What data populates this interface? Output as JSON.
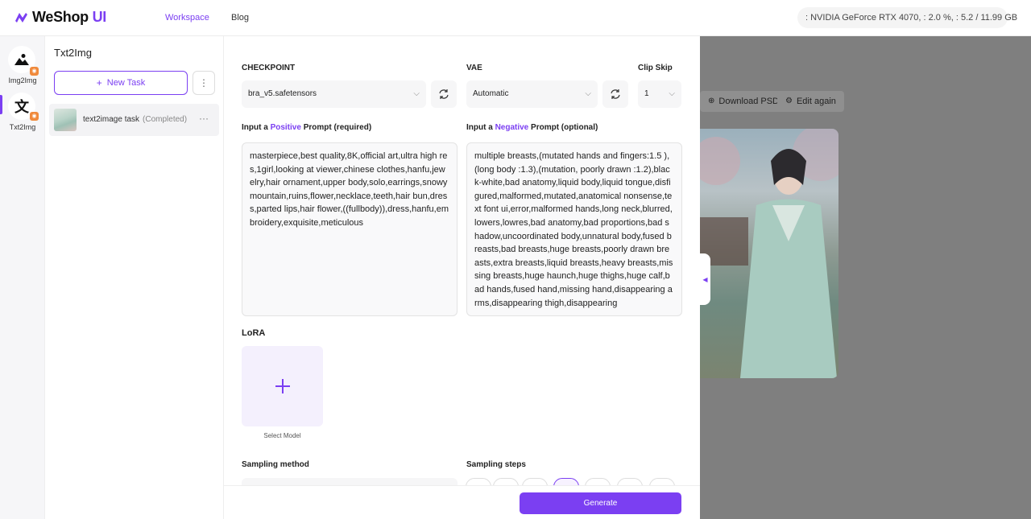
{
  "brand": {
    "name": "WeShop",
    "suffix": " UI"
  },
  "nav": {
    "workspace": "Workspace",
    "blog": "Blog"
  },
  "gpu": {
    "info": ": NVIDIA GeForce RTX 4070, : 2.0 %, : 5.2 / 11.99 GB"
  },
  "rail": {
    "items": [
      {
        "label": "Img2Img",
        "icon": "landscape-icon"
      },
      {
        "label": "Txt2Img",
        "icon": "translate-icon"
      }
    ]
  },
  "tasks": {
    "title": "Txt2Img",
    "new_task": "New Task",
    "items": [
      {
        "name": "text2image task",
        "status": "(Completed)"
      }
    ]
  },
  "preview": {
    "download_psd": "Download PSD",
    "edit_again": "Edit again"
  },
  "controls": {
    "checkpoint_label": "CHECKPOINT",
    "checkpoint_value": "bra_v5.safetensors",
    "vae_label": "VAE",
    "vae_value": "Automatic",
    "clip_skip_label": "Clip Skip",
    "clip_skip_value": "1",
    "positive_label_pre": "Input a ",
    "positive_word": "Positive",
    "positive_label_post": " Prompt (required)",
    "negative_label_pre": "Input a ",
    "negative_word": "Negative",
    "negative_label_post": " Prompt (optional)",
    "positive_prompt": "masterpiece,best quality,8K,official art,ultra high res,1girl,looking at viewer,chinese clothes,hanfu,jewelry,hair ornament,upper body,solo,earrings,snowy mountain,ruins,flower,necklace,teeth,hair bun,dress,parted lips,hair flower,((fullbody)),dress,hanfu,embroidery,exquisite,meticulous",
    "negative_prompt": "multiple breasts,(mutated hands and fingers:1.5 ),(long body :1.3),(mutation, poorly drawn :1.2),black-white,bad anatomy,liquid body,liquid tongue,disfigured,malformed,mutated,anatomical nonsense,text font ui,error,malformed hands,long neck,blurred,lowers,lowres,bad anatomy,bad proportions,bad shadow,uncoordinated body,unnatural body,fused breasts,bad breasts,huge breasts,poorly drawn breasts,extra breasts,liquid breasts,heavy breasts,missing breasts,huge haunch,huge thighs,huge calf,bad hands,fused hand,missing hand,disappearing arms,disappearing thigh,disappearing",
    "lora_label": "LoRA",
    "lora_select": "Select Model",
    "sampling_method_label": "Sampling method",
    "sampling_steps_label": "Sampling steps",
    "generate": "Generate"
  },
  "colors": {
    "accent": "#7b3ff2",
    "badge": "#f08a3c"
  }
}
